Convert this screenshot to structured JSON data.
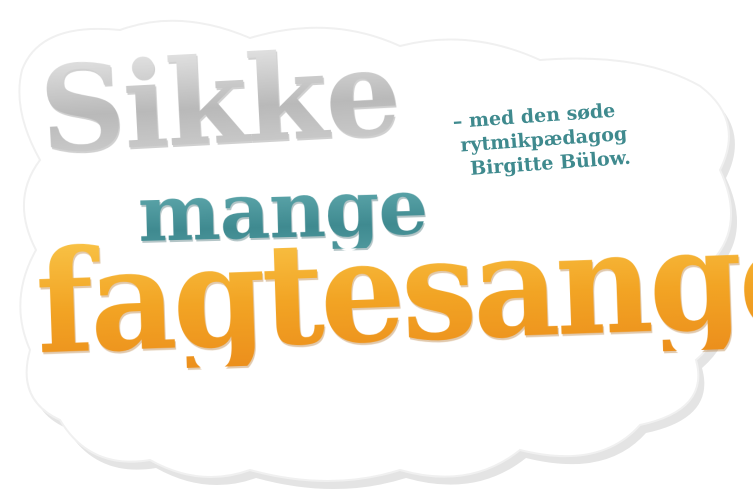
{
  "logo": {
    "line1": "Sikke",
    "line2": "mange",
    "line3": "fagtesange"
  },
  "tagline": {
    "line1": "– med den søde",
    "line2": "rytmikpædagog",
    "line3": "Birgitte Bülow."
  },
  "colors": {
    "grey_word": "#c4c4c4",
    "teal_word": "#4f9aa0",
    "orange_word": "#f2a424",
    "tagline": "#3f8a8e",
    "sticker_fill": "#ffffff",
    "sticker_shadow": "#e4e4e4"
  }
}
